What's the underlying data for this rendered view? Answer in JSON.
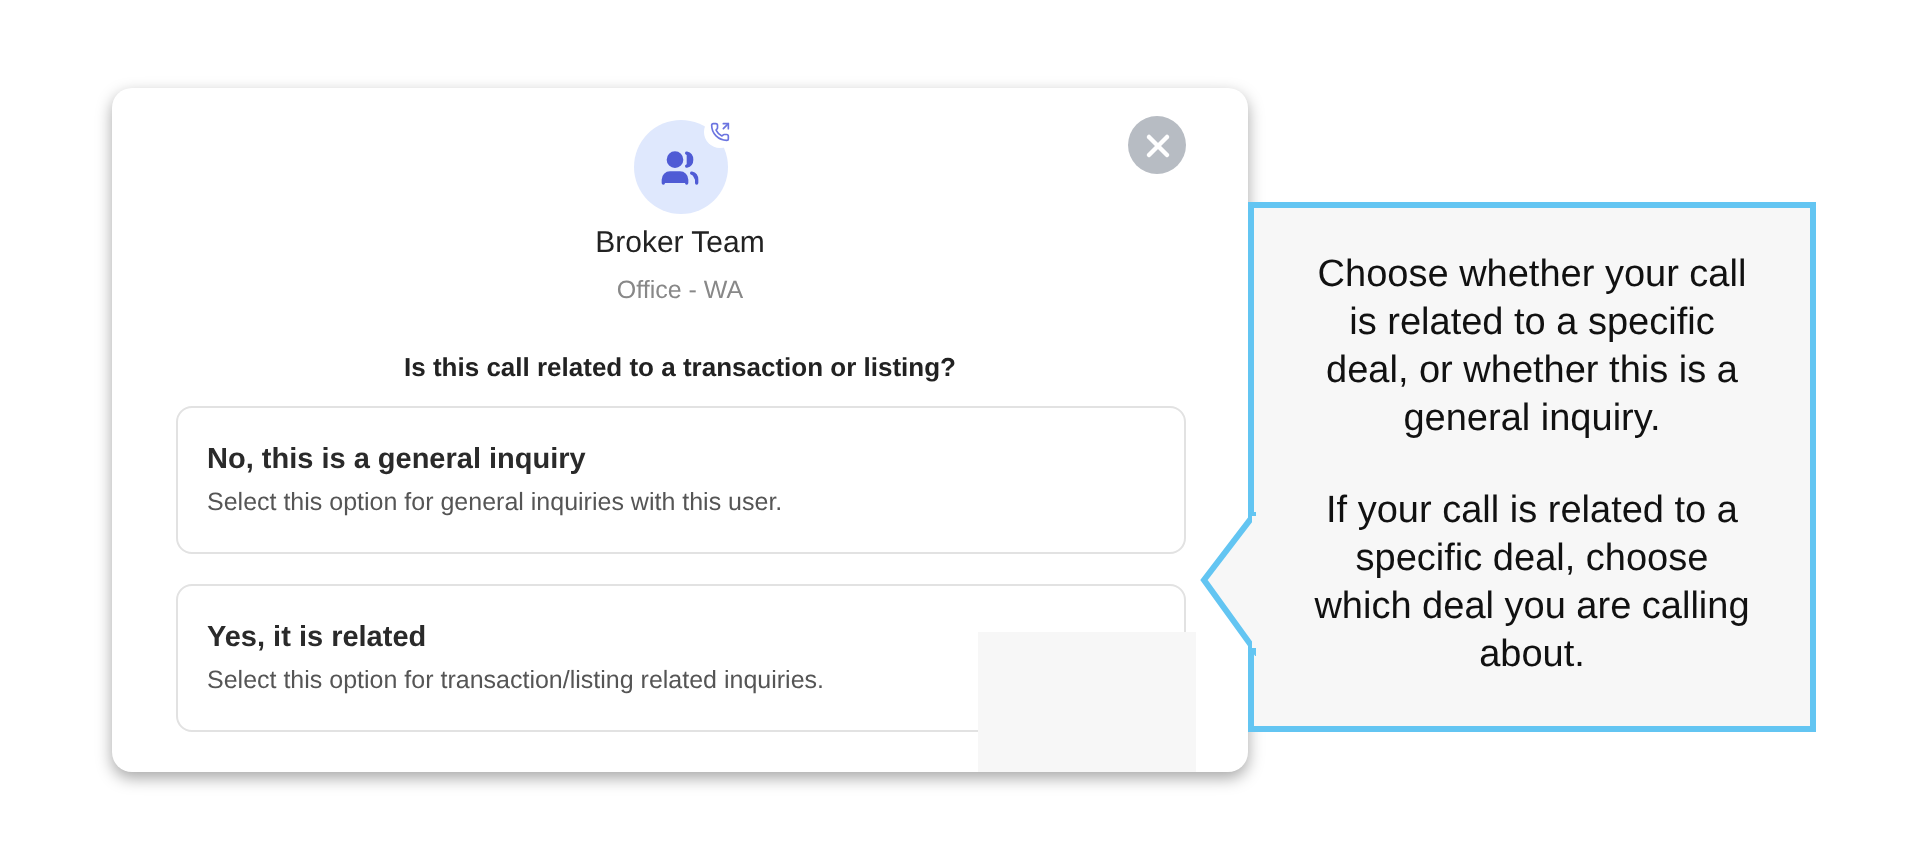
{
  "contact": {
    "name": "Broker Team",
    "subtitle": "Office - WA"
  },
  "question": "Is this call related to a transaction or listing?",
  "options": [
    {
      "title": "No, this is a general inquiry",
      "description": "Select this option for general inquiries with this user."
    },
    {
      "title": "Yes, it is related",
      "description": "Select this option for transaction/listing related inquiries."
    }
  ],
  "callout": {
    "paragraphs": [
      "Choose whether your call is related to a specific deal, or whether this is a general inquiry.",
      "If your call is related to a specific deal, choose which deal you are calling about."
    ]
  }
}
